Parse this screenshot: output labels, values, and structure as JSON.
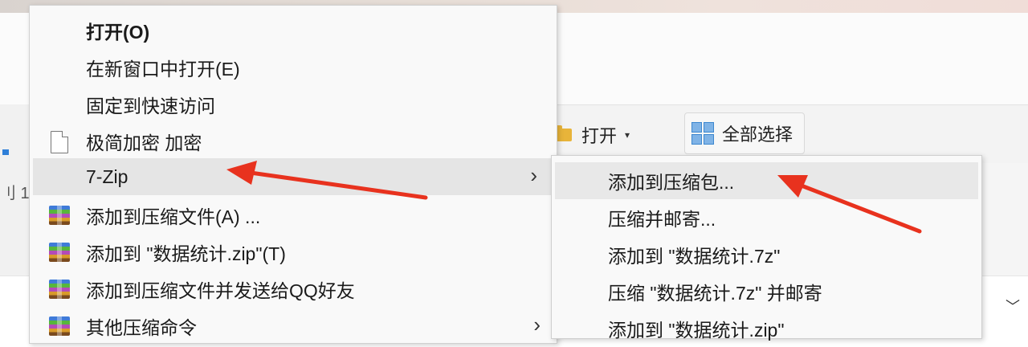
{
  "background": {
    "ribbon": {
      "open_label": "打开",
      "open_caret": "▾",
      "select_all_label": "全部选择"
    },
    "left_glyph": "刂 1",
    "chevron": "﹀"
  },
  "context_menu": {
    "items": [
      {
        "label": "打开(O)",
        "bold": true
      },
      {
        "label": "在新窗口中打开(E)"
      },
      {
        "label": "固定到快速访问"
      },
      {
        "label": "极简加密 加密",
        "icon": "document-icon"
      },
      {
        "label": "7-Zip",
        "submenu_arrow": "›",
        "highlighted": true
      },
      {
        "label": "添加到压缩文件(A) ...",
        "icon": "winrar-archive-icon"
      },
      {
        "label": "添加到 \"数据统计.zip\"(T)",
        "icon": "winrar-archive-icon"
      },
      {
        "label": "添加到压缩文件并发送给QQ好友",
        "icon": "winrar-archive-icon"
      },
      {
        "label": "其他压缩命令",
        "icon": "winrar-archive-icon",
        "submenu_arrow": "›"
      }
    ]
  },
  "submenu_7zip": {
    "items": [
      {
        "label": "添加到压缩包...",
        "highlighted": true
      },
      {
        "label": "压缩并邮寄..."
      },
      {
        "label": "添加到 \"数据统计.7z\""
      },
      {
        "label": "压缩 \"数据统计.7z\" 并邮寄"
      },
      {
        "label": "添加到 \"数据统计.zip\""
      }
    ]
  },
  "annotation_color": "#e8321e"
}
